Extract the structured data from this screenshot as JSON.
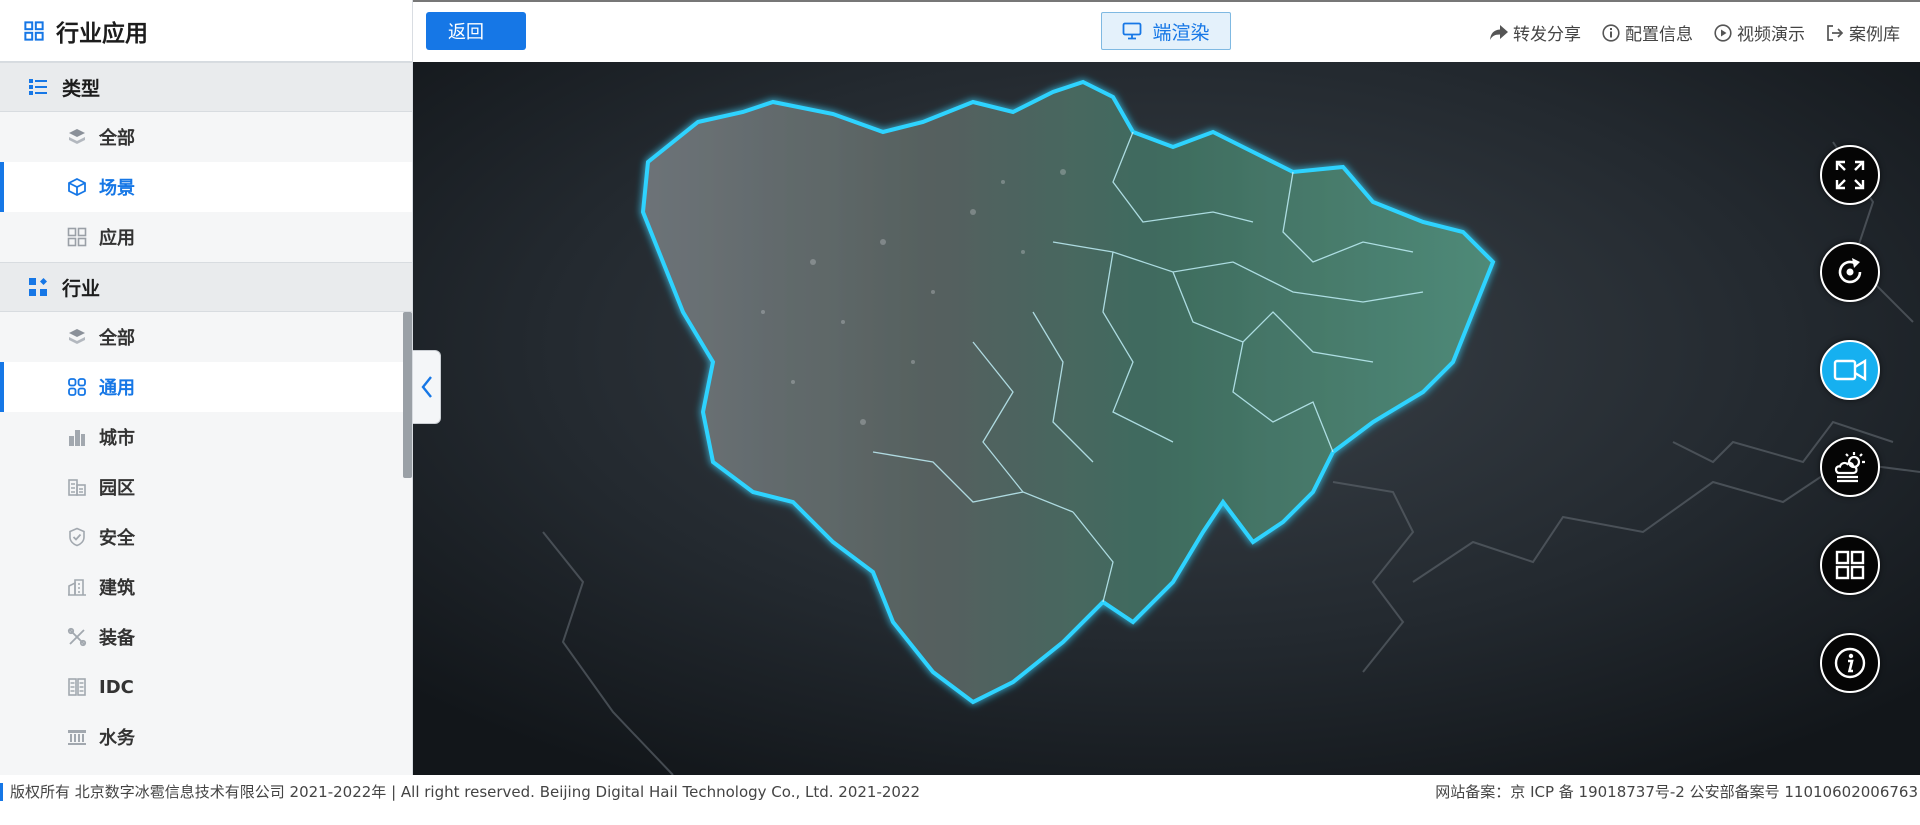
{
  "sidebar": {
    "title": "行业应用",
    "groups": [
      {
        "label": "类型",
        "items": [
          {
            "label": "全部",
            "icon": "layers-icon"
          },
          {
            "label": "场景",
            "icon": "cube-icon"
          },
          {
            "label": "应用",
            "icon": "grid-icon"
          }
        ]
      },
      {
        "label": "行业",
        "items": [
          {
            "label": "全部",
            "icon": "layers-icon"
          },
          {
            "label": "通用",
            "icon": "apps-icon"
          },
          {
            "label": "城市",
            "icon": "city-icon"
          },
          {
            "label": "园区",
            "icon": "park-icon"
          },
          {
            "label": "安全",
            "icon": "shield-icon"
          },
          {
            "label": "建筑",
            "icon": "building-icon"
          },
          {
            "label": "装备",
            "icon": "tools-icon"
          },
          {
            "label": "IDC",
            "icon": "server-icon"
          },
          {
            "label": "水务",
            "icon": "water-icon"
          }
        ]
      }
    ]
  },
  "topbar": {
    "back_label": "返回",
    "render_label": "端渲染",
    "links": [
      {
        "label": "转发分享",
        "icon": "share-icon"
      },
      {
        "label": "配置信息",
        "icon": "info-icon"
      },
      {
        "label": "视频演示",
        "icon": "play-icon"
      },
      {
        "label": "案例库",
        "icon": "exit-icon"
      }
    ]
  },
  "map_controls": [
    {
      "name": "fullscreen-icon",
      "active": false
    },
    {
      "name": "rotate-icon",
      "active": false
    },
    {
      "name": "video-icon",
      "active": true
    },
    {
      "name": "weather-icon",
      "active": false
    },
    {
      "name": "grid-icon",
      "active": false
    },
    {
      "name": "info-icon",
      "active": false
    }
  ],
  "footer": {
    "copyright": "版权所有 北京数字冰雹信息技术有限公司 2021-2022年 | All right reserved. Beijing Digital Hail Technology Co., Ltd. 2021-2022",
    "record": "网站备案：京 ICP 备 19018737号-2 公安部备案号 11010602006763"
  },
  "colors": {
    "accent": "#1677e6",
    "active_control": "#16b0f0",
    "map_outline": "#2fd3ff"
  }
}
